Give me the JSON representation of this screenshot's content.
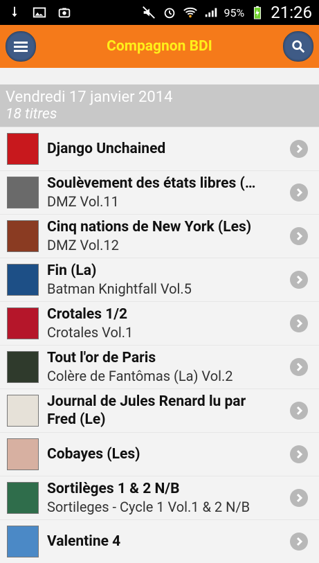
{
  "status": {
    "battery_percent": "95%",
    "time": "21:26"
  },
  "app": {
    "title": "Compagnon BDI"
  },
  "section": {
    "date": "Vendredi 17 janvier 2014",
    "count": "18 titres"
  },
  "items": [
    {
      "title": "Django Unchained",
      "subtitle": "",
      "thumb_color": "#c8181d"
    },
    {
      "title": "Soulèvement des états libres (…",
      "subtitle": "DMZ Vol.11",
      "thumb_color": "#6a6a6a"
    },
    {
      "title": "Cinq nations de New York (Les)",
      "subtitle": "DMZ Vol.12",
      "thumb_color": "#8a3b22"
    },
    {
      "title": "Fin (La)",
      "subtitle": "Batman Knightfall Vol.5",
      "thumb_color": "#1d4f86"
    },
    {
      "title": "Crotales 1/2",
      "subtitle": "Crotales Vol.1",
      "thumb_color": "#b5162a"
    },
    {
      "title": "Tout l'or de Paris",
      "subtitle": "Colère de Fantômas (La) Vol.2",
      "thumb_color": "#2f3a2c"
    },
    {
      "title": "Journal de Jules Renard lu par",
      "subtitle": "Fred (Le)",
      "thumb_color": "#e6e1d8"
    },
    {
      "title": "Cobayes (Les)",
      "subtitle": "",
      "thumb_color": "#d7b0a1"
    },
    {
      "title": "Sortilèges 1 & 2 N/B",
      "subtitle": "Sortileges - Cycle 1 Vol.1 & 2 N/B",
      "thumb_color": "#2f6d4b"
    },
    {
      "title": "Valentine 4",
      "subtitle": "",
      "thumb_color": "#4b89c6"
    }
  ]
}
